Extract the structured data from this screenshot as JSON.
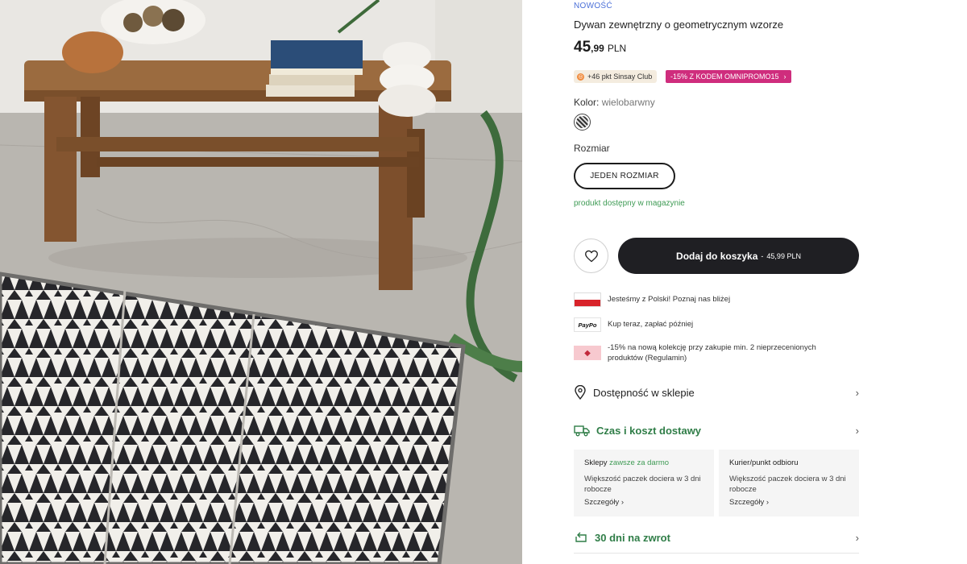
{
  "product": {
    "badge": "NOWOŚĆ",
    "title": "Dywan zewnętrzny o geometrycznym wzorze",
    "price_int": "45",
    "price_dec": ",99",
    "currency": "PLN",
    "club_chip": "+46 pkt Sinsay Club",
    "promo_chip": "-15% Z KODEM OMNIPROMO15",
    "color_label": "Kolor:",
    "color_value": "wielobarwny",
    "size_label": "Rozmiar",
    "size_option": "JEDEN ROZMIAR",
    "stock_text": "produkt dostępny w magazynie"
  },
  "actions": {
    "cart_label": "Dodaj do koszyka",
    "cart_sep": " - ",
    "cart_amount": "45,99 PLN"
  },
  "info": {
    "poland": "Jesteśmy z Polski! Poznaj nas bliżej",
    "paypo_logo": "PayPo",
    "paypo": "Kup teraz, zapłać później",
    "promo": "-15% na nową kolekcję przy zakupie min. 2 nieprzecenionych produktów (Regulamin)"
  },
  "accordion": {
    "store": "Dostępność w sklepie",
    "delivery": "Czas i koszt dostawy",
    "returns": "30 dni na zwrot"
  },
  "delivery_cards": [
    {
      "title": "Sklepy",
      "highlight": "zawsze za darmo",
      "text": "Większość paczek dociera w 3 dni robocze",
      "link": "Szczegóły ›"
    },
    {
      "title": "Kurier/punkt odbioru",
      "highlight": "",
      "text": "Większość paczek dociera w 3 dni robocze",
      "link": "Szczegóły ›"
    }
  ],
  "icons": {
    "heart": "heart-icon",
    "pin": "map-pin-icon",
    "truck": "truck-icon",
    "return": "return-icon",
    "chevron": "chevron-right-icon"
  },
  "colors": {
    "promo_pink": "#cf2d7d",
    "stock_green": "#3f9b55",
    "cart_dark": "#1f1f23",
    "badge_blue": "#4a6fd8"
  }
}
